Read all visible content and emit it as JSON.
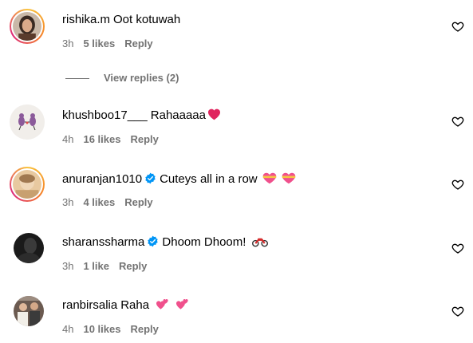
{
  "comments": [
    {
      "username": "rishika.m",
      "text": "Oot kotuwah",
      "time": "3h",
      "likes": "5 likes",
      "reply": "Reply",
      "verified": false,
      "avatar_icon": "woman-portrait-avatar",
      "emojis": []
    },
    {
      "username": "khushboo17___",
      "text": "Rahaaaaa",
      "time": "4h",
      "likes": "16 likes",
      "reply": "Reply",
      "verified": false,
      "avatar_icon": "cartoon-figures-avatar",
      "emojis": [
        "red-heart-emoji"
      ]
    },
    {
      "username": "anuranjan1010",
      "text": "Cuteys all in a row",
      "time": "3h",
      "likes": "4 likes",
      "reply": "Reply",
      "verified": true,
      "avatar_icon": "blurred-portrait-avatar",
      "emojis": [
        "heart-with-ribbon-emoji",
        "heart-with-ribbon-emoji"
      ]
    },
    {
      "username": "sharanssharma",
      "text": "Dhoom Dhoom!",
      "time": "3h",
      "likes": "1 like",
      "reply": "Reply",
      "verified": true,
      "avatar_icon": "dark-portrait-avatar",
      "emojis": [
        "motorcycle-emoji"
      ]
    },
    {
      "username": "ranbirsalia",
      "text": "Raha",
      "time": "4h",
      "likes": "10 likes",
      "reply": "Reply",
      "verified": false,
      "avatar_icon": "group-photo-avatar",
      "emojis": [
        "two-hearts-emoji",
        "two-hearts-emoji"
      ]
    }
  ],
  "view_replies": "View replies (2)",
  "colors": {
    "meta_text": "#737373",
    "verified_blue": "#0095f6",
    "story_ring": [
      "#f9c33c",
      "#f58529",
      "#dd2a7b"
    ],
    "heart_red": "#e0245e",
    "pink_heart": "#f0508c"
  },
  "icons": {
    "like": "heart-outline-icon",
    "verified": "verified-badge-icon"
  }
}
